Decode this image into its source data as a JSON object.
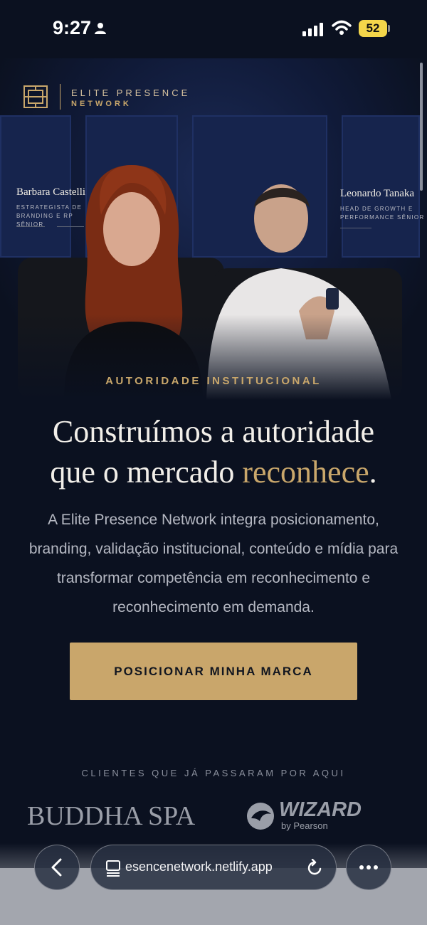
{
  "status_bar": {
    "time": "9:27",
    "battery": "52",
    "icons": [
      "person-icon",
      "signal-icon",
      "wifi-icon",
      "battery-icon"
    ]
  },
  "brand": {
    "line1": "ELITE PRESENCE",
    "line2": "NETWORK",
    "colors": {
      "gold": "#c9a76b",
      "navy": "#0b1120"
    }
  },
  "people": [
    {
      "name": "Barbara Castelli",
      "role_line1": "ESTRATEGISTA DE",
      "role_line2": "BRANDING E RP SÊNIOR"
    },
    {
      "name": "Leonardo Tanaka",
      "role_line1": "HEAD DE GROWTH E",
      "role_line2": "PERFORMANCE SÊNIOR"
    }
  ],
  "hero": {
    "eyebrow": "AUTORIDADE INSTITUCIONAL",
    "headline_line1": "Construímos a autoridade",
    "headline_line2_start": "que o mercado ",
    "headline_accent": "reconhece",
    "headline_end": ".",
    "body": "A Elite Presence Network integra posicionamento, branding, validação institucional, conteúdo e mídia para transformar competência em reconhecimento e reconhecimento em demanda.",
    "cta": "POSICIONAR MINHA MARCA"
  },
  "clients": {
    "label": "CLIENTES QUE JÁ PASSARAM POR AQUI",
    "logos": [
      {
        "name": "BUDDHA SPA"
      },
      {
        "name": "WIZARD",
        "sub": "by Pearson"
      }
    ]
  },
  "browser": {
    "url": "esencenetwork.netlify.app",
    "icons": [
      "back-icon",
      "tabs-icon",
      "reload-icon",
      "more-icon"
    ]
  }
}
